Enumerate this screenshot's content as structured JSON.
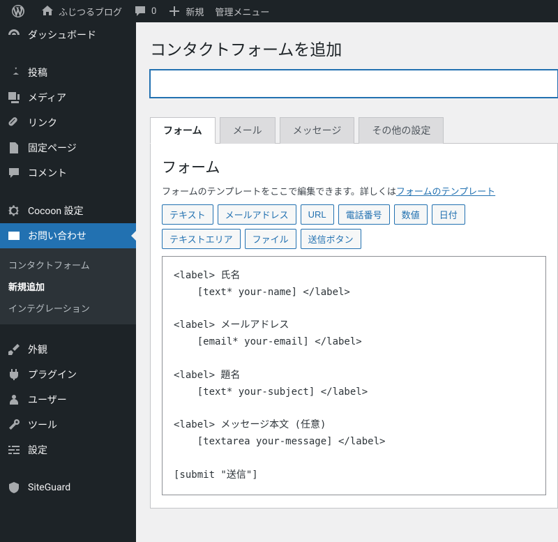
{
  "adminbar": {
    "site_name": "ふじつるブログ",
    "comment_count": "0",
    "new_label": "新規",
    "admin_menu": "管理メニュー"
  },
  "sidebar": {
    "dashboard": "ダッシュボード",
    "posts": "投稿",
    "media": "メディア",
    "links": "リンク",
    "pages": "固定ページ",
    "comments": "コメント",
    "cocoon": "Cocoon 設定",
    "contact": "お問い合わせ",
    "contact_sub": {
      "forms": "コンタクトフォーム",
      "add": "新規追加",
      "integration": "インテグレーション"
    },
    "appearance": "外観",
    "plugins": "プラグイン",
    "users": "ユーザー",
    "tools": "ツール",
    "settings": "設定",
    "siteguard": "SiteGuard"
  },
  "page": {
    "title": "コンタクトフォームを追加",
    "title_input_value": ""
  },
  "tabs": {
    "form": "フォーム",
    "mail": "メール",
    "messages": "メッセージ",
    "other": "その他の設定"
  },
  "form_panel": {
    "heading": "フォーム",
    "legend_pre": "フォームのテンプレートをここで編集できます。詳しくは",
    "legend_link": "フォームのテンプレート",
    "buttons": {
      "text": "テキスト",
      "email": "メールアドレス",
      "url": "URL",
      "tel": "電話番号",
      "number": "数値",
      "date": "日付",
      "textarea": "テキストエリア",
      "file": "ファイル",
      "submit": "送信ボタン"
    },
    "template": "<label> 氏名\n    [text* your-name] </label>\n\n<label> メールアドレス\n    [email* your-email] </label>\n\n<label> 題名\n    [text* your-subject] </label>\n\n<label> メッセージ本文 (任意)\n    [textarea your-message] </label>\n\n[submit \"送信\"]"
  }
}
